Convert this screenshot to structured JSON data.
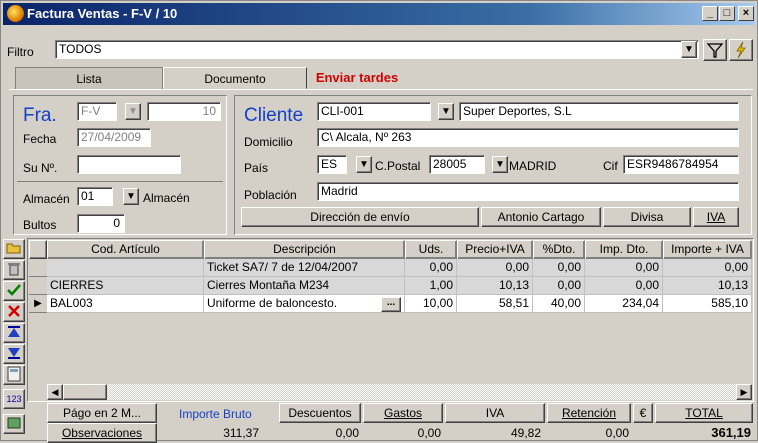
{
  "window": {
    "title": "Factura Ventas - F-V / 10"
  },
  "filter": {
    "label": "Filtro",
    "value": "TODOS"
  },
  "tabs": [
    {
      "label": "Lista"
    },
    {
      "label": "Documento"
    },
    {
      "label": "Enviar tardes"
    }
  ],
  "doc": {
    "fra_label": "Fra.",
    "serie": "F-V",
    "number": "10",
    "fecha_label": "Fecha",
    "fecha": "27/04/2009",
    "su_label": "Su Nº.",
    "su_value": "",
    "almacen_label": "Almacén",
    "almacen_code": "01",
    "almacen_name": "Almacén",
    "bultos_label": "Bultos",
    "bultos": "0"
  },
  "client": {
    "label": "Cliente",
    "code": "CLI-001",
    "name": "Super Deportes, S.L",
    "domicilio_label": "Domicilio",
    "domicilio": "C\\ Alcala, Nº 263",
    "pais_label": "País",
    "pais": "ES",
    "cpostal_label": "C.Postal",
    "cpostal": "28005",
    "provincia": "MADRID",
    "cif_label": "Cif",
    "cif": "ESR9486784954",
    "poblacion_label": "Población",
    "poblacion": "Madrid",
    "buttons": {
      "direccion": "Dirección de envío",
      "agente": "Antonio Cartago",
      "divisa": "Divisa",
      "iva": "IVA"
    }
  },
  "table": {
    "headers": [
      "Cod. Artículo",
      "Descripción",
      "Uds.",
      "Precio+IVA",
      "%Dto.",
      "Imp. Dto.",
      "Importe + IVA"
    ],
    "rows": [
      {
        "code": "",
        "desc": "Ticket SA7/ 7 de 12/04/2007",
        "uds": "0,00",
        "precio": "0,00",
        "dto": "0,00",
        "impdto": "0,00",
        "importe": "0,00"
      },
      {
        "code": "CIERRES",
        "desc": "Cierres Montaña M234",
        "uds": "1,00",
        "precio": "10,13",
        "dto": "0,00",
        "impdto": "0,00",
        "importe": "10,13"
      },
      {
        "code": "BAL003",
        "desc": "Uniforme de baloncesto.",
        "uds": "10,00",
        "precio": "58,51",
        "dto": "40,00",
        "impdto": "234,04",
        "importe": "585,10"
      }
    ],
    "ellipsis": "...",
    "row_marker": "▶"
  },
  "toolbar_icons": [
    "folder-open-icon",
    "trash-icon",
    "check-icon",
    "cancel-icon",
    "move-top-icon",
    "move-bottom-icon",
    "calculator-icon",
    "numbering-icon",
    "import-icon"
  ],
  "footer": {
    "pago": "Págo en 2 M...",
    "observaciones": "Observaciones",
    "importe_bruto_label": "Importe Bruto",
    "importe_bruto": "311,37",
    "descuentos_label": "Descuentos",
    "descuentos": "0,00",
    "gastos_label": "Gastos",
    "gastos": "0,00",
    "iva_label": "IVA",
    "iva": "49,82",
    "retencion_label": "Retención",
    "retencion": "0,00",
    "euro": "€",
    "total_label": "TOTAL",
    "total": "361,19"
  },
  "colors": {
    "titlebar": "#0a246a",
    "accent_blue": "#1540c8",
    "tab_red": "#d00000",
    "face": "#d4d0c8"
  }
}
